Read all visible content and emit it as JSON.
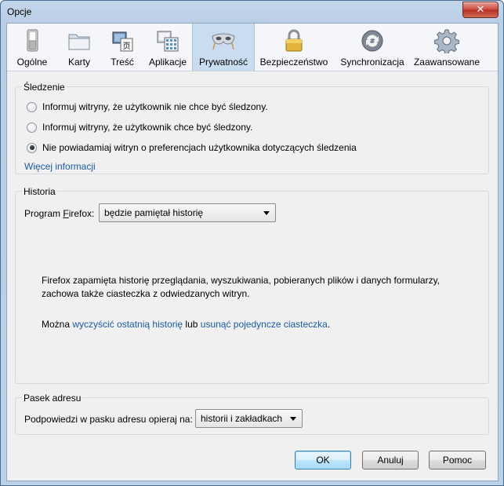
{
  "window": {
    "title": "Opcje",
    "close_glyph": "✕"
  },
  "tabs": [
    {
      "label": "Ogólne",
      "icon": "switch-icon",
      "selected": false
    },
    {
      "label": "Karty",
      "icon": "folder-icon",
      "selected": false
    },
    {
      "label": "Treść",
      "icon": "content-icon",
      "selected": false
    },
    {
      "label": "Aplikacje",
      "icon": "applications-icon",
      "selected": false
    },
    {
      "label": "Prywatność",
      "icon": "mask-icon",
      "selected": true
    },
    {
      "label": "Bezpieczeństwo",
      "icon": "padlock-icon",
      "selected": false
    },
    {
      "label": "Synchronizacja",
      "icon": "sync-icon",
      "selected": false
    },
    {
      "label": "Zaawansowane",
      "icon": "gear-icon",
      "selected": false
    }
  ],
  "tracking": {
    "legend": "Śledzenie",
    "options": [
      {
        "label": "Informuj witryny, że użytkownik nie chce być śledzony.",
        "checked": false
      },
      {
        "label": "Informuj witryny, że użytkownik chce być śledzony.",
        "checked": false
      },
      {
        "label": "Nie powiadamiaj witryn o preferencjach użytkownika dotyczących śledzenia",
        "checked": true
      }
    ],
    "more_info": "Więcej informacji"
  },
  "history": {
    "legend": "Historia",
    "program_label_pre": "Program ",
    "program_label_accel": "F",
    "program_label_post": "irefox:",
    "mode": "będzie pamiętał historię",
    "desc_line1": "Firefox zapamięta historię przeglądania, wyszukiwania, pobieranych plików i danych formularzy,",
    "desc_line2": "zachowa także ciasteczka z odwiedzanych witryn.",
    "clear_pre": "Można ",
    "clear_link": "wyczyścić ostatnią historię",
    "clear_mid": " lub ",
    "cookies_link": "usunąć pojedyncze ciasteczka",
    "clear_post": "."
  },
  "location_bar": {
    "legend": "Pasek adresu",
    "suggest_label": "Podpowiedzi w pasku adresu opieraj na:",
    "suggest_value": "historii i zakładkach"
  },
  "buttons": {
    "ok": "OK",
    "cancel": "Anuluj",
    "help": "Pomoc"
  },
  "colors": {
    "link": "#1a5aa8",
    "selected_tab": "#c9dcf0",
    "frame": "#bcd0e6"
  }
}
